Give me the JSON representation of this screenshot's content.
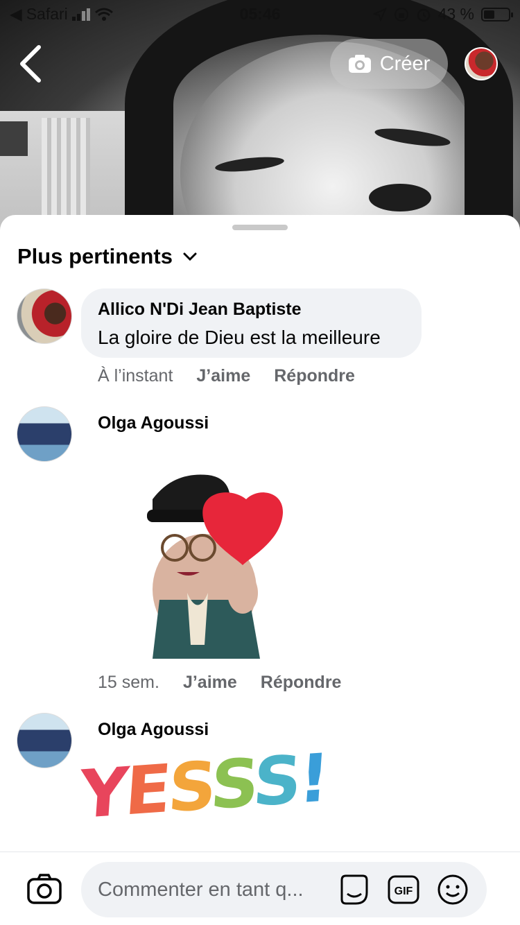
{
  "status_bar": {
    "back_app": "Safari",
    "time": "05:46",
    "battery": "43 %"
  },
  "header": {
    "create_label": "Créer"
  },
  "sort": {
    "label": "Plus pertinents"
  },
  "comments": [
    {
      "author": "Allico N'Di Jean Baptiste",
      "text": "La gloire de Dieu est la meilleure",
      "time": "À l’instant",
      "like_label": "J’aime",
      "reply_label": "Répondre"
    },
    {
      "author": "Olga Agoussi",
      "sticker": "heart-sticker",
      "time": "15 sem.",
      "like_label": "J’aime",
      "reply_label": "Répondre"
    },
    {
      "author": "Olga Agoussi",
      "sticker": "yess-sticker",
      "sticker_text": [
        "Y",
        "E",
        "S",
        "S",
        "S",
        "!"
      ]
    }
  ],
  "composer": {
    "placeholder": "Commenter en tant q..."
  },
  "colors": {
    "bubble": "#f0f2f5",
    "meta_text": "#65676b",
    "primary_text": "#050505"
  }
}
